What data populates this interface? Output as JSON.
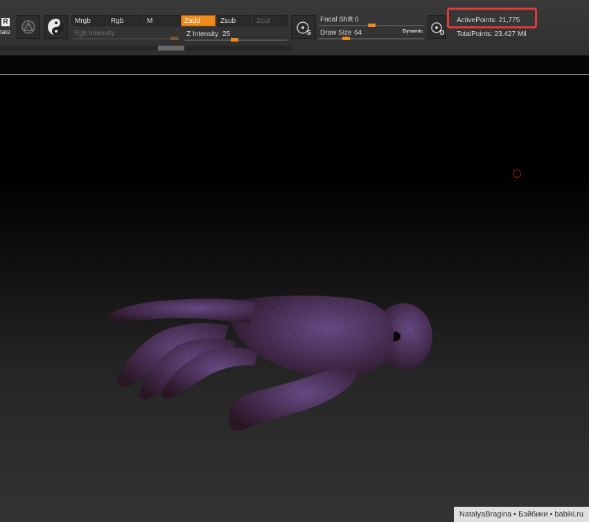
{
  "toolbar": {
    "rotate_label": "tate",
    "rgb_mode_buttons": [
      {
        "label": "Mrgb",
        "active": false
      },
      {
        "label": "Rgb",
        "active": false
      },
      {
        "label": "M",
        "active": false
      }
    ],
    "z_mode_buttons": [
      {
        "label": "Zadd",
        "active": true
      },
      {
        "label": "Zsub",
        "active": false
      },
      {
        "label": "Zcut",
        "active": false,
        "disabled": true
      }
    ],
    "rgb_intensity": {
      "label": "Rgb Intensity",
      "disabled": true
    },
    "z_intensity": {
      "label": "Z Intensity",
      "value": "25"
    },
    "focal_shift": {
      "label": "Focal Shift",
      "value": "0"
    },
    "draw_size": {
      "label": "Draw Size",
      "value": "64"
    },
    "dynamic_label": "Dynamic",
    "stroke_icon_letter": "S",
    "brush_icon_letter": "D",
    "rotate_icon_letter": "R",
    "active_points": "ActivePoints: 21,775",
    "total_points": "TotalPoints: 23.427 Mil"
  },
  "colors": {
    "accent": "#f08a1c",
    "highlight": "#e23a3a"
  },
  "watermark": "NatalyaBragina • Бэйбики • babiki.ru"
}
